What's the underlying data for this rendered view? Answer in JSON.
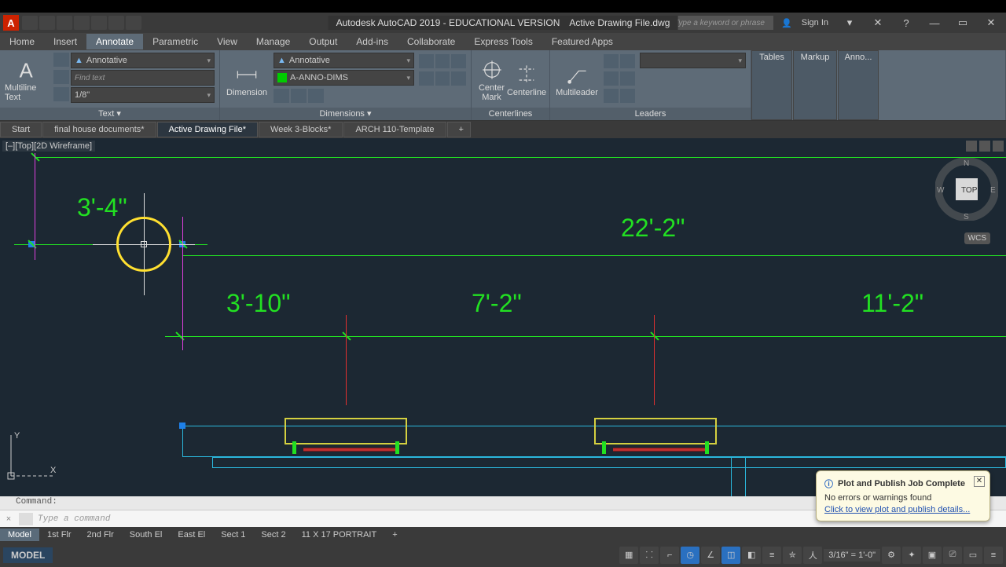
{
  "title": {
    "app": "Autodesk AutoCAD 2019 - EDUCATIONAL VERSION",
    "doc": "Active Drawing File.dwg",
    "search_ph": "Type a keyword or phrase",
    "signin": "Sign In"
  },
  "tabs": {
    "items": [
      "Home",
      "Insert",
      "Annotate",
      "Parametric",
      "View",
      "Manage",
      "Output",
      "Add-ins",
      "Collaborate",
      "Express Tools",
      "Featured Apps"
    ],
    "active": "Annotate"
  },
  "ribbon": {
    "text_panel": {
      "big": "Multiline Text",
      "style": "Annotative",
      "find_ph": "Find text",
      "height": "1/8\"",
      "title": "Text"
    },
    "dim_panel": {
      "big": "Dimension",
      "style": "Annotative",
      "layer": "A-ANNO-DIMS",
      "title": "Dimensions"
    },
    "center_panel": {
      "b1": "Center Mark",
      "b2": "Centerline",
      "title": "Centerlines"
    },
    "leader_panel": {
      "big": "Multileader",
      "title": "Leaders"
    },
    "more": {
      "tables": "Tables",
      "markup": "Markup",
      "anno": "Anno..."
    }
  },
  "file_tabs": {
    "items": [
      "Start",
      "final house documents*",
      "Active Drawing File*",
      "Week 3-Blocks*",
      "ARCH 110-Template"
    ],
    "active": 2
  },
  "viewport": {
    "label": "[–][Top][2D Wireframe]",
    "wcs": "WCS",
    "cube": "TOP"
  },
  "dims": {
    "d1": "3'-4\"",
    "d2": "22'-2\"",
    "d3": "3'-10\"",
    "d4": "7'-2\"",
    "d5": "11'-2\""
  },
  "command": {
    "hist": "Command:",
    "ph": "Type a command"
  },
  "layout_tabs": {
    "items": [
      "Model",
      "1st Flr",
      "2nd Flr",
      "South El",
      "East El",
      "Sect 1",
      "Sect 2",
      "11 X 17 PORTRAIT"
    ],
    "active": 0
  },
  "status": {
    "model": "MODEL",
    "scale": "3/16\" = 1'-0\""
  },
  "balloon": {
    "title": "Plot and Publish Job Complete",
    "msg": "No errors or warnings found",
    "link": "Click to view plot and publish details..."
  }
}
